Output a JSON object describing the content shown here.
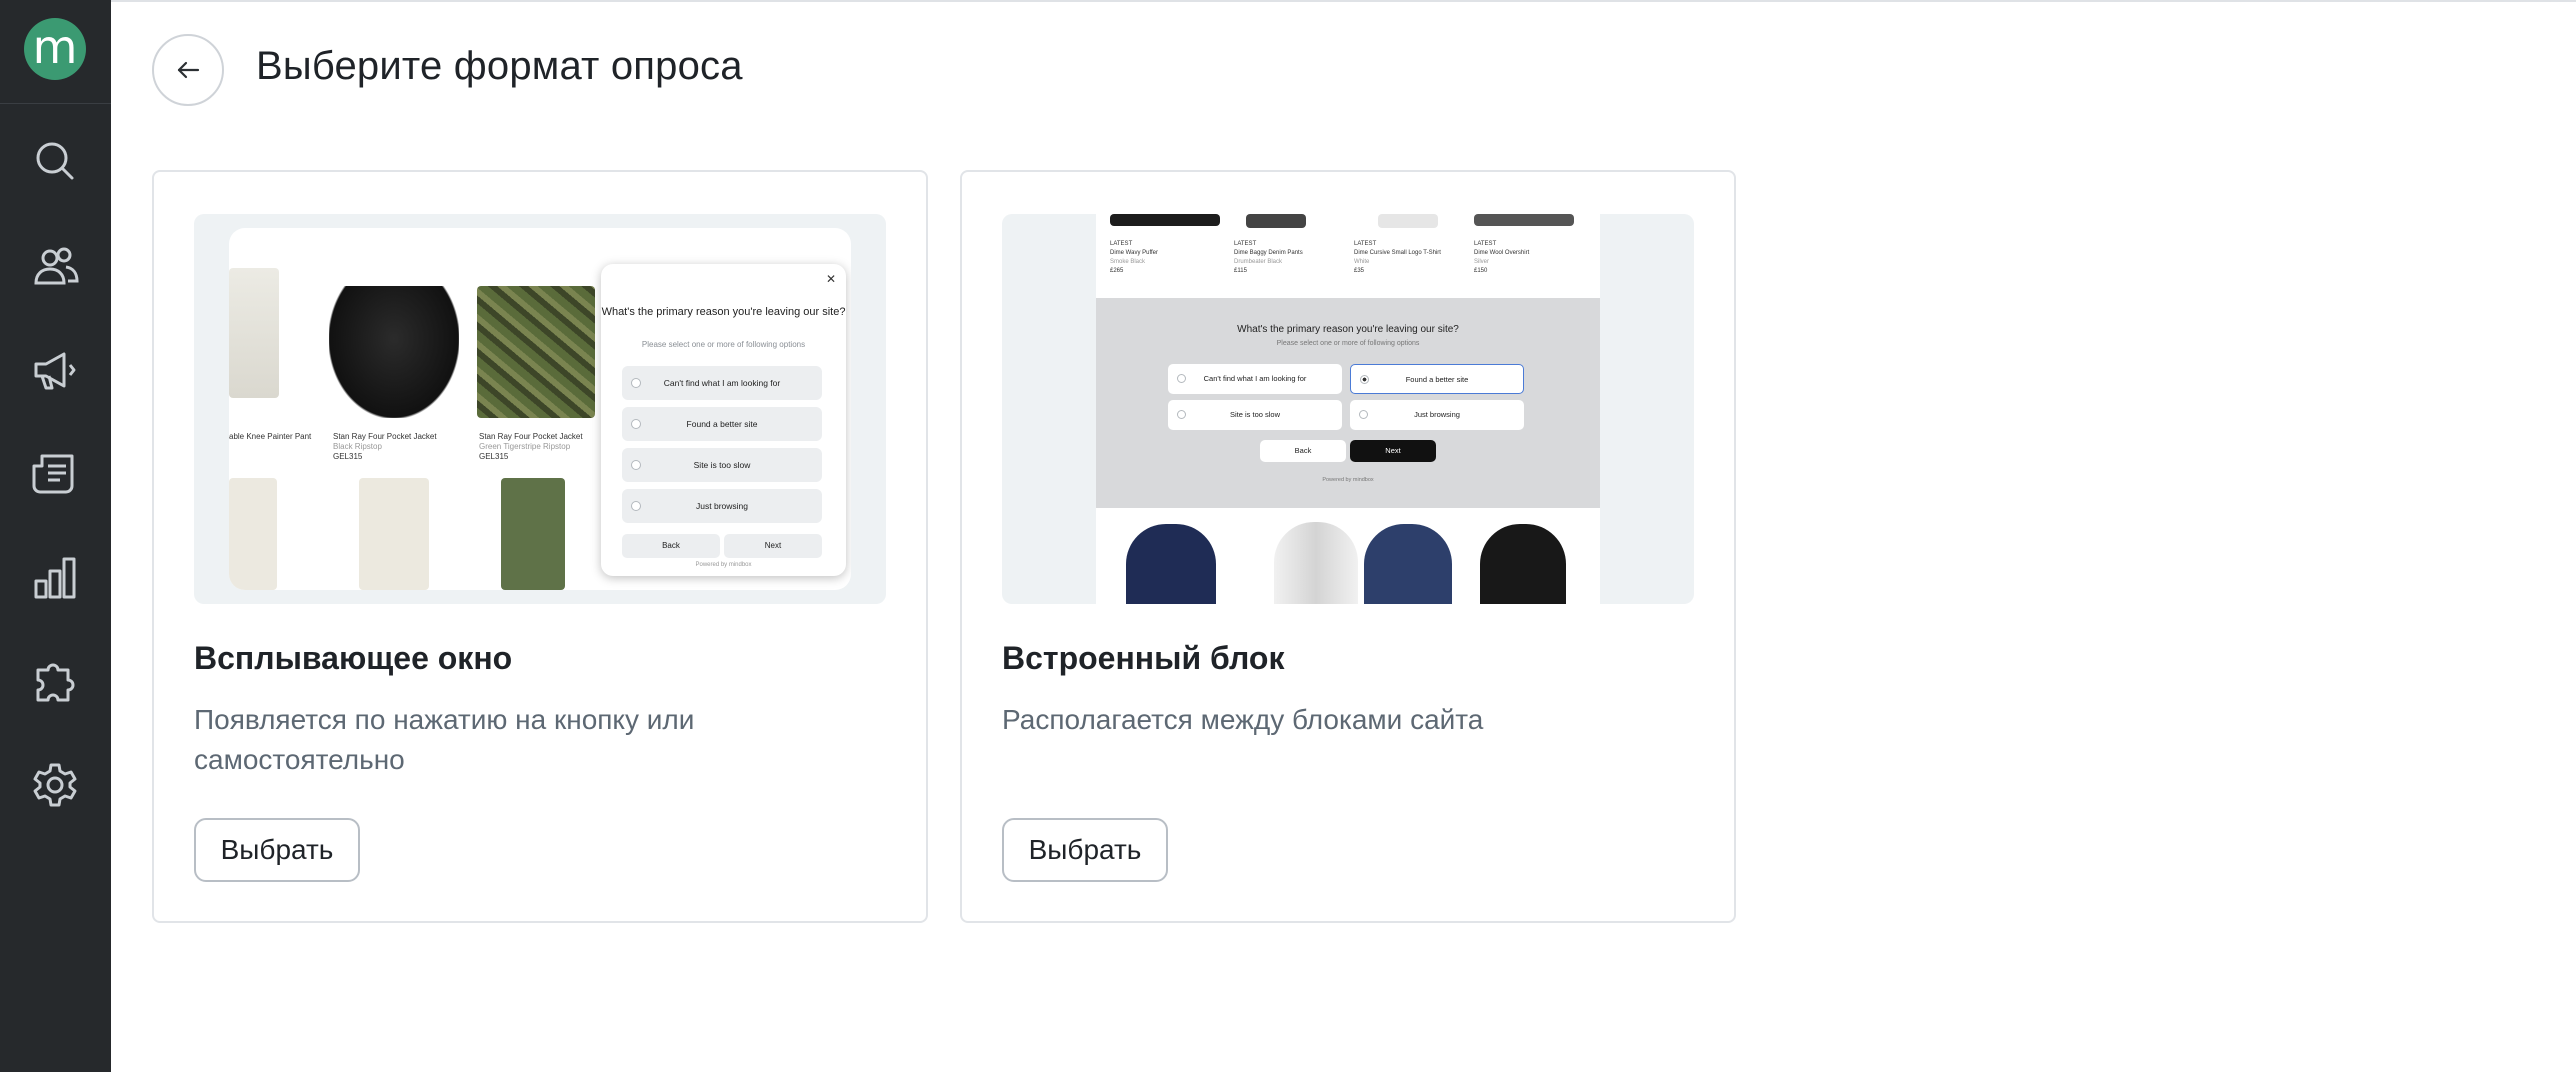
{
  "page": {
    "title": "Выберите формат опроса",
    "back_icon": "arrow-left-icon"
  },
  "sidebar": {
    "logo_letter": "m",
    "items": [
      {
        "icon": "search-icon"
      },
      {
        "icon": "users-icon"
      },
      {
        "icon": "megaphone-icon"
      },
      {
        "icon": "document-list-icon"
      },
      {
        "icon": "bar-chart-icon"
      },
      {
        "icon": "puzzle-icon"
      },
      {
        "icon": "gear-icon"
      }
    ]
  },
  "cards": [
    {
      "title": "Всплывающее окно",
      "description": "Появляется по нажатию на кнопку или самостоятельно",
      "button": "Выбрать",
      "preview": {
        "question": "What's the primary reason you're leaving our site?",
        "subtitle": "Please select one or more of following options",
        "options": [
          "Can't find what I am looking for",
          "Found a better site",
          "Site is too slow",
          "Just browsing"
        ],
        "back": "Back",
        "next": "Next",
        "powered": "Powered by mindbox",
        "products": [
          {
            "name": "Stan Ray Four Pocket Jacket",
            "variant": "Black Ripstop",
            "price": "GEL315"
          },
          {
            "name": "Stan Ray Four Pocket Jacket",
            "variant": "Green Tigerstripe Ripstop",
            "price": "GEL315"
          },
          {
            "name": "able Knee Painter Pant"
          }
        ]
      }
    },
    {
      "title": "Встроенный блок",
      "description": "Располагается между блоками сайта",
      "button": "Выбрать",
      "preview": {
        "question": "What's the primary reason you're leaving our site?",
        "subtitle": "Please select one or more of following options",
        "options": [
          "Can't find what I am looking for",
          "Found a better site",
          "Site is too slow",
          "Just browsing"
        ],
        "selected_option": "Found a better site",
        "back": "Back",
        "next": "Next",
        "powered": "Powered by mindbox",
        "products": [
          {
            "badge": "LATEST",
            "name": "Dime Wavy Puffer",
            "variant": "Smoke Black",
            "price": "£265"
          },
          {
            "badge": "LATEST",
            "name": "Dime Baggy Denim Pants",
            "variant": "Drumbeater Black",
            "price": "£115"
          },
          {
            "badge": "LATEST",
            "name": "Dime Cursive Small Logo T-Shirt",
            "variant": "White",
            "price": "£35"
          },
          {
            "badge": "LATEST",
            "name": "Dime Wool Overshirt",
            "variant": "Silver",
            "price": "£150"
          }
        ]
      }
    }
  ],
  "colors": {
    "sidebar_bg": "#26292c",
    "logo_bg": "#3b9a72",
    "card_border": "#e1e4e8",
    "description_text": "#5d6873"
  }
}
